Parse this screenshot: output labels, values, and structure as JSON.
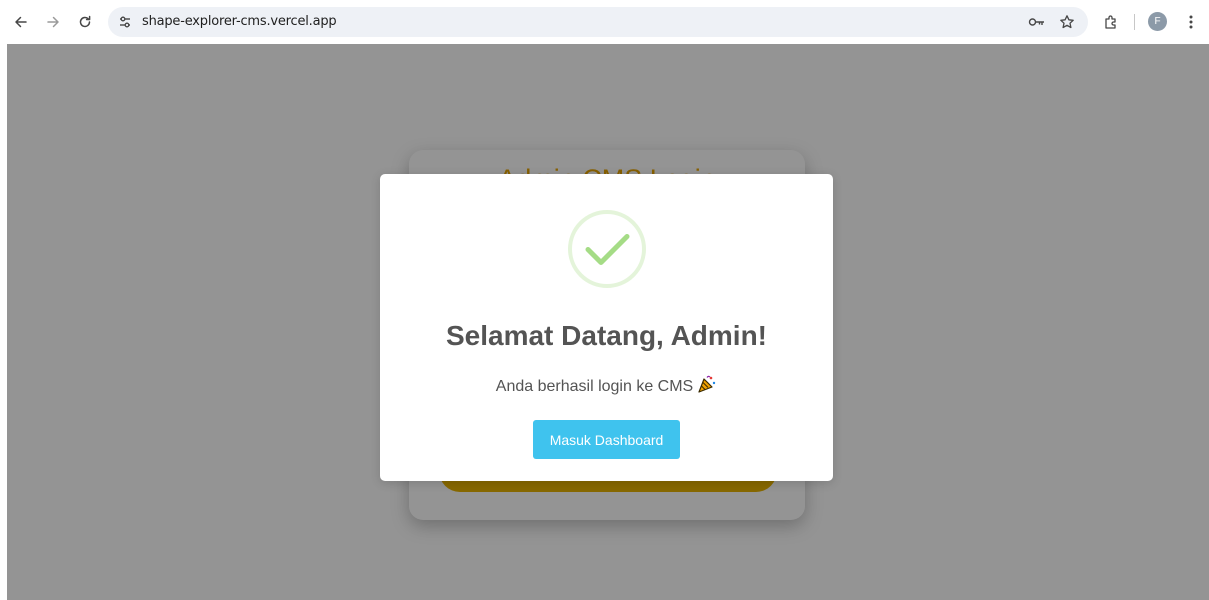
{
  "browser": {
    "url": "shape-explorer-cms.vercel.app",
    "profile_initial": "F",
    "icons": {
      "back": "arrow-left-icon",
      "forward": "arrow-right-icon",
      "reload": "reload-icon",
      "site_info": "tune-icon",
      "password": "key-icon",
      "bookmark": "star-icon",
      "extensions": "puzzle-icon",
      "menu": "kebab-menu-icon"
    }
  },
  "login_card": {
    "title": "Admin CMS Login"
  },
  "modal": {
    "title": "Selamat Datang, Admin!",
    "message": "Anda berhasil login ke CMS",
    "confirm_label": "Masuk Dashboard",
    "icon": "success-check-icon"
  },
  "colors": {
    "accent": "#3fc3ee",
    "success": "#a5dc86",
    "login_title": "#e8a500",
    "login_button": "#e8b400"
  }
}
